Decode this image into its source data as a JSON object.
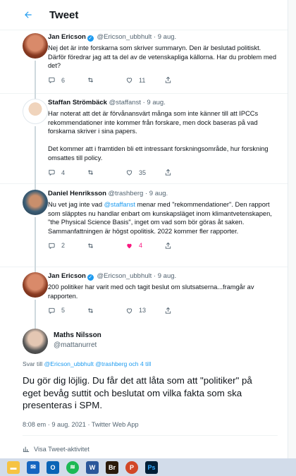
{
  "header": {
    "title": "Tweet"
  },
  "replies": [
    {
      "name": "Jan Ericson",
      "verified": true,
      "handle": "@Ericson_ubbhult",
      "time": "9 aug.",
      "text": "Nej det är inte forskarna som skriver summaryn. Den är beslutad politiskt. Därför föredrar jag att ta del av de vetenskapliga källorna. Har du problem med det?",
      "replies": "6",
      "retweets": "",
      "likes": "11"
    },
    {
      "name": "Staffan Strömbäck",
      "handle": "@staffanst",
      "time": "9 aug.",
      "text": "Har noterat att det är förvånansvärt många som inte känner till att IPCCs rekommendationer inte kommer från forskare, men dock baseras på vad forskarna skriver i sina papers.\n\nDet kommer att i framtiden bli ett intressant forskningsområde, hur forskning omsattes till policy.",
      "replies": "4",
      "retweets": "",
      "likes": "35"
    },
    {
      "name": "Daniel Henriksson",
      "handle": "@trashberg",
      "time": "9 aug.",
      "text_before": "Nu vet jag inte vad ",
      "mention": "@staffanst",
      "text_after": " menar med \"rekommendationer\". Den rapport som släpptes nu handlar enbart om kunskapsläget inom klimantvetenskapen, \"the Physical Science Basis\", inget om vad som bör göras åt saken.\nSammanfattningen är högst opolitisk. 2022 kommer fler rapporter.",
      "replies": "2",
      "retweets": "",
      "likes": "4"
    },
    {
      "name": "Jan Ericson",
      "verified": true,
      "handle": "@Ericson_ubbhult",
      "time": "9 aug.",
      "text": "200 politiker har varit med och tagit beslut om slutsatserna...framgår av rapporten.",
      "replies": "5",
      "retweets": "",
      "likes": "13"
    }
  ],
  "main_tweet": {
    "name": "Maths Nilsson",
    "handle": "@mattanurret",
    "replying_prefix": "Svar till ",
    "replying_to": "@Ericson_ubbhult @trashberg",
    "replying_more": "och 4 till",
    "text": "Du gör dig löjlig. Du får det att låta som att \"politiker\" på eget bevåg suttit och beslutat om vilka fakta som ska presenteras i SPM.",
    "timestamp": "8:08 em · 9 aug. 2021 · Twitter Web App",
    "activity_label": "Visa Tweet-aktivitet"
  },
  "taskbar": {
    "apps": [
      "file-explorer",
      "mail",
      "outlook",
      "spotify",
      "word",
      "bridge",
      "powerpoint",
      "photoshop"
    ],
    "labels": {
      "bridge": "Br",
      "photoshop": "Ps",
      "word": "W",
      "outlook": "O"
    }
  },
  "colors": {
    "accent": "#1d9bf0",
    "like": "#f91880",
    "text": "#0f1419",
    "muted": "#536471"
  }
}
